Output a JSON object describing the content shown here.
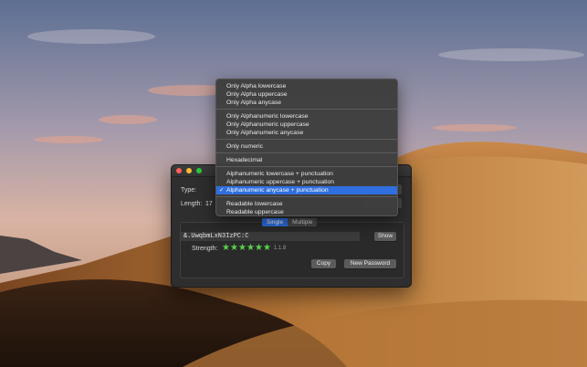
{
  "window": {
    "type_label": "Type:",
    "length_label": "Length:",
    "length_value": "17",
    "segments": {
      "single": "Single",
      "multiple": "Multiple",
      "selected": "Single"
    },
    "password": "&.UwqbmLxN3IzPC:C",
    "show_label": "Show",
    "strength_label": "Strength:",
    "strength_stars": 6,
    "bits_label": "1.1.8",
    "copy_label": "Copy",
    "new_password_label": "New Password"
  },
  "menu": {
    "items": [
      "Only Alpha lowercase",
      "Only Alpha uppercase",
      "Only Alpha anycase",
      "Only Alphanumeric lowercase",
      "Only Alphanumeric uppercase",
      "Only Alphanumeric anycase",
      "Only numeric",
      "Hexadecimal",
      "Alphanumeric lowercase + punctuation",
      "Alphanumeric uppercase + punctuation",
      "Alphanumeric anycase + punctuation",
      "Readable lowercase",
      "Readable uppercase"
    ],
    "selected_index": 10,
    "check_mark": "✓"
  },
  "colors": {
    "accent": "#2f6fdf",
    "star_green": "#58d34a",
    "window_bg": "#2e2e2e"
  },
  "icons": {
    "star": "star-icon",
    "check": "checkmark-icon"
  }
}
